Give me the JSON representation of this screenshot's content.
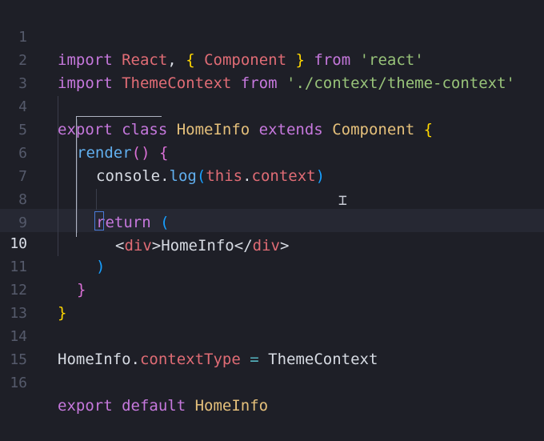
{
  "editor": {
    "language": "javascript",
    "active_line": 10,
    "lines": [
      {
        "n": "1"
      },
      {
        "n": "2"
      },
      {
        "n": "3"
      },
      {
        "n": "4"
      },
      {
        "n": "5"
      },
      {
        "n": "6"
      },
      {
        "n": "7"
      },
      {
        "n": "8"
      },
      {
        "n": "9"
      },
      {
        "n": "10"
      },
      {
        "n": "11"
      },
      {
        "n": "12"
      },
      {
        "n": "13"
      },
      {
        "n": "14"
      },
      {
        "n": "15"
      },
      {
        "n": "16"
      }
    ],
    "tokens": {
      "l1": {
        "import": "import",
        "react": "React",
        "comma": ", ",
        "lb": "{",
        "component": " Component ",
        "rb": "}",
        "from": " from ",
        "str": "'react'"
      },
      "l2": {
        "import": "import",
        "themecontext": " ThemeContext",
        "from": " from ",
        "str": "'./context/theme-context'"
      },
      "l4": {
        "export": "export",
        "class": " class ",
        "name": "HomeInfo",
        "extends": " extends ",
        "component": "Component",
        "lb": " {"
      },
      "l5": {
        "render": "render",
        "parens": "()",
        "lb": " {"
      },
      "l6": {
        "console": "console",
        "dot": ".",
        "log": "log",
        "lp": "(",
        "this": "this",
        "dot2": ".",
        "context": "context",
        "rp": ")"
      },
      "l8": {
        "return": "return",
        "lp": " ("
      },
      "l9": {
        "lt": "<",
        "div": "div",
        "gt": ">",
        "text": "HomeInfo",
        "lt2": "</",
        "div2": "div",
        "gt2": ">"
      },
      "l10": {
        "rp": ")"
      },
      "l11": {
        "rb": "}"
      },
      "l12": {
        "rb": "}"
      },
      "l14": {
        "name": "HomeInfo",
        "dot": ".",
        "prop": "contextType",
        "eq": " = ",
        "value": "ThemeContext"
      },
      "l16": {
        "export": "export",
        "default": " default ",
        "name": "HomeInfo"
      }
    }
  },
  "colors": {
    "background": "#1e1f27",
    "keyword": "#c678dd",
    "identifier": "#e06c75",
    "class_name": "#e5c07b",
    "function": "#61afef",
    "string": "#98c379"
  },
  "icons": {
    "text_cursor": "i-beam-icon"
  }
}
